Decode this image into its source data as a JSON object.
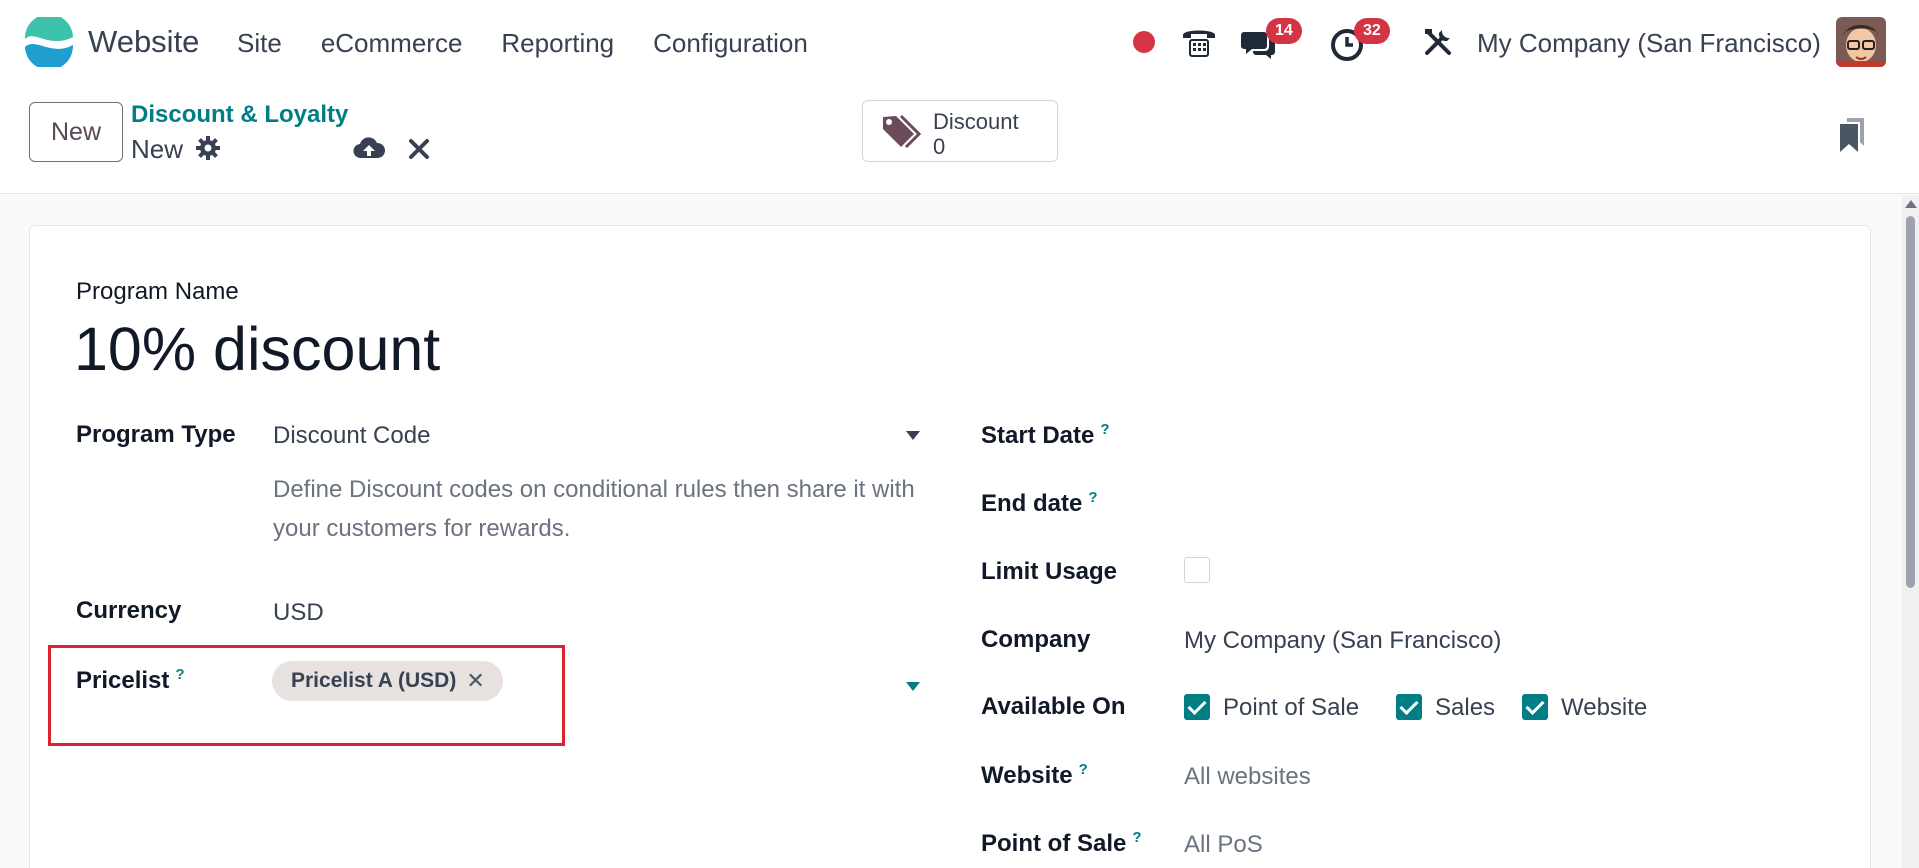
{
  "navbar": {
    "app_name": "Website",
    "menu": [
      "Site",
      "eCommerce",
      "Reporting",
      "Configuration"
    ],
    "chat_badge": "14",
    "activity_badge": "32",
    "company": "My Company (San Francisco)"
  },
  "control": {
    "new_label": "New",
    "breadcrumb_parent": "Discount & Loyalty",
    "breadcrumb_current": "New",
    "smart_button": {
      "label": "Discount",
      "value": "0"
    }
  },
  "form": {
    "program_name_label": "Program Name",
    "program_name": "10% discount",
    "program_type_label": "Program Type",
    "program_type": "Discount Code",
    "program_type_desc": "Define Discount codes on conditional rules then share it with your customers for rewards.",
    "currency_label": "Currency",
    "currency": "USD",
    "pricelist_label": "Pricelist",
    "pricelist_tag": "Pricelist A (USD)",
    "start_date_label": "Start Date",
    "end_date_label": "End date",
    "limit_usage_label": "Limit Usage",
    "company_label": "Company",
    "company": "My Company (San Francisco)",
    "available_on_label": "Available On",
    "available_on": [
      "Point of Sale",
      "Sales",
      "Website"
    ],
    "website_label": "Website",
    "website_placeholder": "All websites",
    "pos_label": "Point of Sale",
    "pos_placeholder": "All PoS"
  },
  "colors": {
    "brand": "#017e84",
    "accent": "#5b4654",
    "badge": "#d53445",
    "highlight": "#d9232e"
  }
}
